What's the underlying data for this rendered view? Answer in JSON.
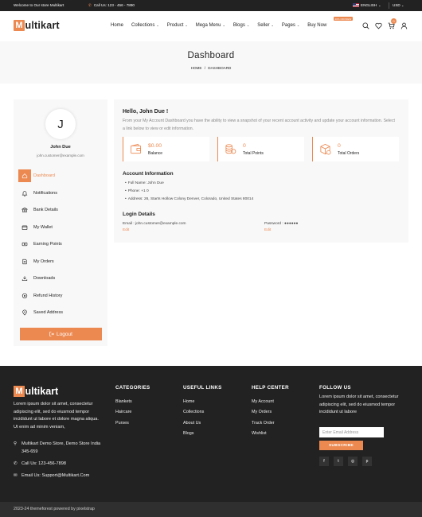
{
  "colors": {
    "accent": "#ec8951",
    "dark": "#222222",
    "light_bg": "#f8f8f8"
  },
  "topbar": {
    "welcome": "Welcome to Our store Multikart",
    "call": "Call Us: 123 - 456 - 7890",
    "language": "ENGLISH",
    "currency": "USD"
  },
  "header": {
    "logo_m": "M",
    "logo_rest": "ultikart",
    "nav": [
      {
        "label": "Home",
        "dropdown": false
      },
      {
        "label": "Collections",
        "dropdown": true
      },
      {
        "label": "Product",
        "dropdown": true
      },
      {
        "label": "Mega Menu",
        "dropdown": true
      },
      {
        "label": "Blogs",
        "dropdown": true
      },
      {
        "label": "Seller",
        "dropdown": true
      },
      {
        "label": "Pages",
        "dropdown": true
      },
      {
        "label": "Buy Now",
        "dropdown": false
      }
    ],
    "hot_badge": "20% OFF/NEW",
    "cart_count": "0",
    "icons": [
      "search-icon",
      "heart-icon",
      "cart-icon",
      "user-icon"
    ]
  },
  "breadcrumb": {
    "title": "Dashboard",
    "home": "HOME",
    "current": "DASHBOARD",
    "separator": "/"
  },
  "sidebar": {
    "avatar_letter": "J",
    "name": "John Due",
    "email": "john.customer@example.com",
    "items": [
      {
        "label": "Dashboard",
        "icon": "home-icon",
        "active": true
      },
      {
        "label": "Notifications",
        "icon": "bell-icon",
        "active": false
      },
      {
        "label": "Bank Details",
        "icon": "bank-icon",
        "active": false
      },
      {
        "label": "My Wallet",
        "icon": "wallet-icon",
        "active": false
      },
      {
        "label": "Earning Points",
        "icon": "coins-icon",
        "active": false
      },
      {
        "label": "My Orders",
        "icon": "orders-icon",
        "active": false
      },
      {
        "label": "Downloads",
        "icon": "download-icon",
        "active": false
      },
      {
        "label": "Refund History",
        "icon": "refund-icon",
        "active": false
      },
      {
        "label": "Saved Address",
        "icon": "pin-icon",
        "active": false
      }
    ],
    "logout": "Logout"
  },
  "dashboard": {
    "greeting": "Hello, John Due !",
    "intro": "From your My Account Dashboard you have the ability to view a snapshot of your recent account activity and update your account information. Select a link below to view or edit information.",
    "stats": [
      {
        "value": "$0.00",
        "label": "Balance",
        "icon": "wallet-icon"
      },
      {
        "value": "0",
        "label": "Total Points",
        "icon": "coins-icon"
      },
      {
        "value": "0",
        "label": "Total Orders",
        "icon": "box-icon"
      }
    ],
    "account_title": "Account Information",
    "account_items": [
      "Full Name: John Due",
      "Phone: +1 0",
      "Address: 26, Starts Hollow Colony Denver, Colorado, United States 80014"
    ],
    "login_title": "Login Details",
    "login_email": "Email : john.customer@example.com",
    "login_password": "Password : ●●●●●●",
    "edit": "Edit"
  },
  "footer": {
    "logo_m": "M",
    "logo_rest": "ultikart",
    "about": "Lorem ipsum dolor sit amet, consectetur adipiscing elit, sed do eiusmod tempor incididunt ut labore et dolore magna aliqua. Ut enim ad minim veniam,",
    "address": "Multikart Demo Store, Demo Store India 345-659",
    "phone": "Call Us: 123-456-7898",
    "email": "Email Us: Support@Multikart.Com",
    "columns": [
      {
        "title": "CATEGORIES",
        "links": [
          "Blankets",
          "Haircare",
          "Purses"
        ]
      },
      {
        "title": "USEFUL LINKS",
        "links": [
          "Home",
          "Collections",
          "About Us",
          "Blogs"
        ]
      },
      {
        "title": "HELP CENTER",
        "links": [
          "My Account",
          "My Orders",
          "Track Order",
          "Wishlist"
        ]
      }
    ],
    "follow_title": "FOLLOW US",
    "follow_text": "Lorem ipsum dolor sit amet, consectetur adipiscing elit, sed do eiusmod tempor incididunt ut labore",
    "email_placeholder": "Enter Email Address",
    "subscribe": "SUBSCRIBE",
    "social": [
      "f",
      "t",
      "◎",
      "p"
    ],
    "social_icons": [
      "facebook-icon",
      "twitter-icon",
      "instagram-icon",
      "pinterest-icon"
    ]
  },
  "copyright": "2023-24 themeforest powered by pixelstrap"
}
